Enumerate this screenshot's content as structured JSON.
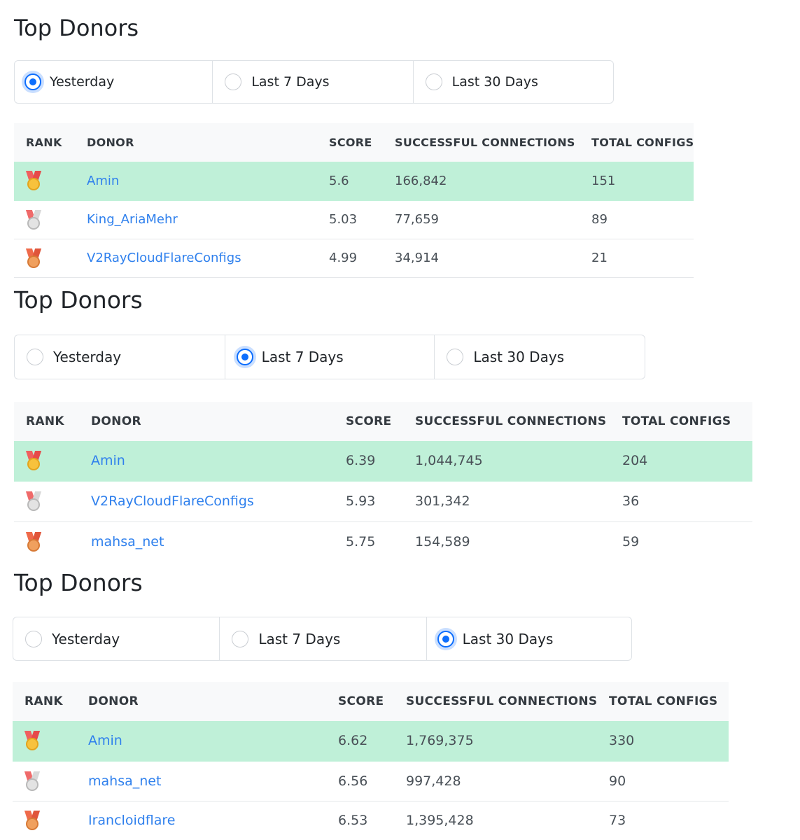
{
  "columns": {
    "rank": "RANK",
    "donor": "DONOR",
    "score": "SCORE",
    "connections": "SUCCESSFUL CONNECTIONS",
    "configs": "TOTAL CONFIGS"
  },
  "panels": [
    {
      "title": "Top Donors",
      "options": [
        {
          "label": "Yesterday",
          "checked": true
        },
        {
          "label": "Last 7 Days",
          "checked": false
        },
        {
          "label": "Last 30 Days",
          "checked": false
        }
      ],
      "rows": [
        {
          "medal": "gold-medal-icon",
          "donor": "Amin",
          "score": "5.6",
          "connections": "166,842",
          "configs": "151"
        },
        {
          "medal": "silver-medal-icon",
          "donor": "King_AriaMehr",
          "score": "5.03",
          "connections": "77,659",
          "configs": "89"
        },
        {
          "medal": "bronze-medal-icon",
          "donor": "V2RayCloudFlareConfigs",
          "score": "4.99",
          "connections": "34,914",
          "configs": "21"
        }
      ]
    },
    {
      "title": "Top Donors",
      "options": [
        {
          "label": "Yesterday",
          "checked": false
        },
        {
          "label": "Last 7 Days",
          "checked": true
        },
        {
          "label": "Last 30 Days",
          "checked": false
        }
      ],
      "rows": [
        {
          "medal": "gold-medal-icon",
          "donor": "Amin",
          "score": "6.39",
          "connections": "1,044,745",
          "configs": "204"
        },
        {
          "medal": "silver-medal-icon",
          "donor": "V2RayCloudFlareConfigs",
          "score": "5.93",
          "connections": "301,342",
          "configs": "36"
        },
        {
          "medal": "bronze-medal-icon",
          "donor": "mahsa_net",
          "score": "5.75",
          "connections": "154,589",
          "configs": "59"
        }
      ]
    },
    {
      "title": "Top Donors",
      "options": [
        {
          "label": "Yesterday",
          "checked": false
        },
        {
          "label": "Last 7 Days",
          "checked": false
        },
        {
          "label": "Last 30 Days",
          "checked": true
        }
      ],
      "rows": [
        {
          "medal": "gold-medal-icon",
          "donor": "Amin",
          "score": "6.62",
          "connections": "1,769,375",
          "configs": "330"
        },
        {
          "medal": "silver-medal-icon",
          "donor": "mahsa_net",
          "score": "6.56",
          "connections": "997,428",
          "configs": "90"
        },
        {
          "medal": "bronze-medal-icon",
          "donor": "Irancloidflare",
          "score": "6.53",
          "connections": "1,395,428",
          "configs": "73"
        }
      ]
    }
  ]
}
